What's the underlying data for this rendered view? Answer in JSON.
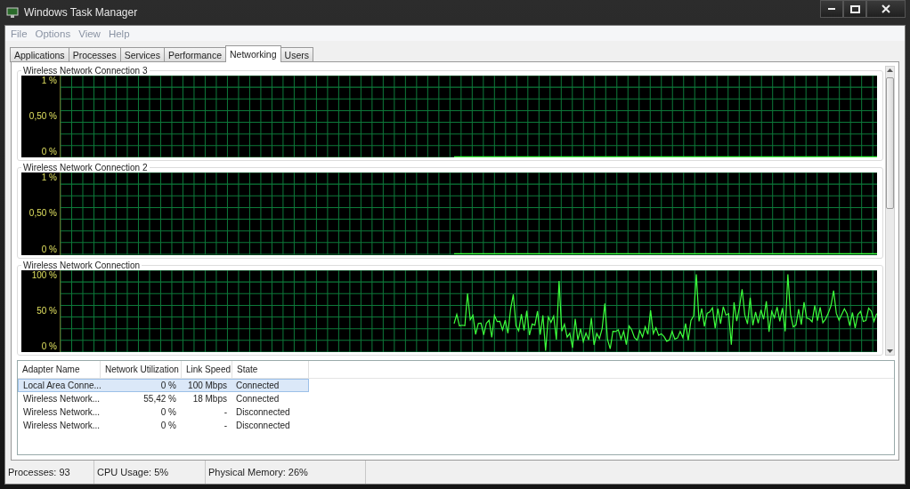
{
  "window": {
    "title": "Windows Task Manager"
  },
  "menu": [
    "File",
    "Options",
    "View",
    "Help"
  ],
  "tabs": [
    {
      "label": "Applications",
      "selected": false
    },
    {
      "label": "Processes",
      "selected": false
    },
    {
      "label": "Services",
      "selected": false
    },
    {
      "label": "Performance",
      "selected": false
    },
    {
      "label": "Networking",
      "selected": true
    },
    {
      "label": "Users",
      "selected": false
    }
  ],
  "graphs": [
    {
      "title": "Wireless Network Connection 3",
      "y_labels": [
        "1 %",
        "0,50 %",
        "0 %"
      ],
      "kind": "flat"
    },
    {
      "title": "Wireless Network Connection 2",
      "y_labels": [
        "1 %",
        "0,50 %",
        "0 %"
      ],
      "kind": "flat"
    },
    {
      "title": "Wireless Network Connection",
      "y_labels": [
        "100 %",
        "50 %",
        "0 %"
      ],
      "kind": "busy"
    }
  ],
  "table": {
    "columns": [
      "Adapter Name",
      "Network Utilization",
      "Link Speed",
      "State"
    ],
    "rows": [
      {
        "cells": [
          "Local Area Conne...",
          "0 %",
          "100 Mbps",
          "Connected"
        ],
        "selected": true
      },
      {
        "cells": [
          "Wireless Network...",
          "55,42 %",
          "18 Mbps",
          "Connected"
        ],
        "selected": false
      },
      {
        "cells": [
          "Wireless Network...",
          "0 %",
          "-",
          "Disconnected"
        ],
        "selected": false
      },
      {
        "cells": [
          "Wireless Network...",
          "0 %",
          "-",
          "Disconnected"
        ],
        "selected": false
      }
    ]
  },
  "status_bar": [
    "Processes: 93",
    "CPU Usage: 5%",
    "Physical Memory: 26%"
  ]
}
